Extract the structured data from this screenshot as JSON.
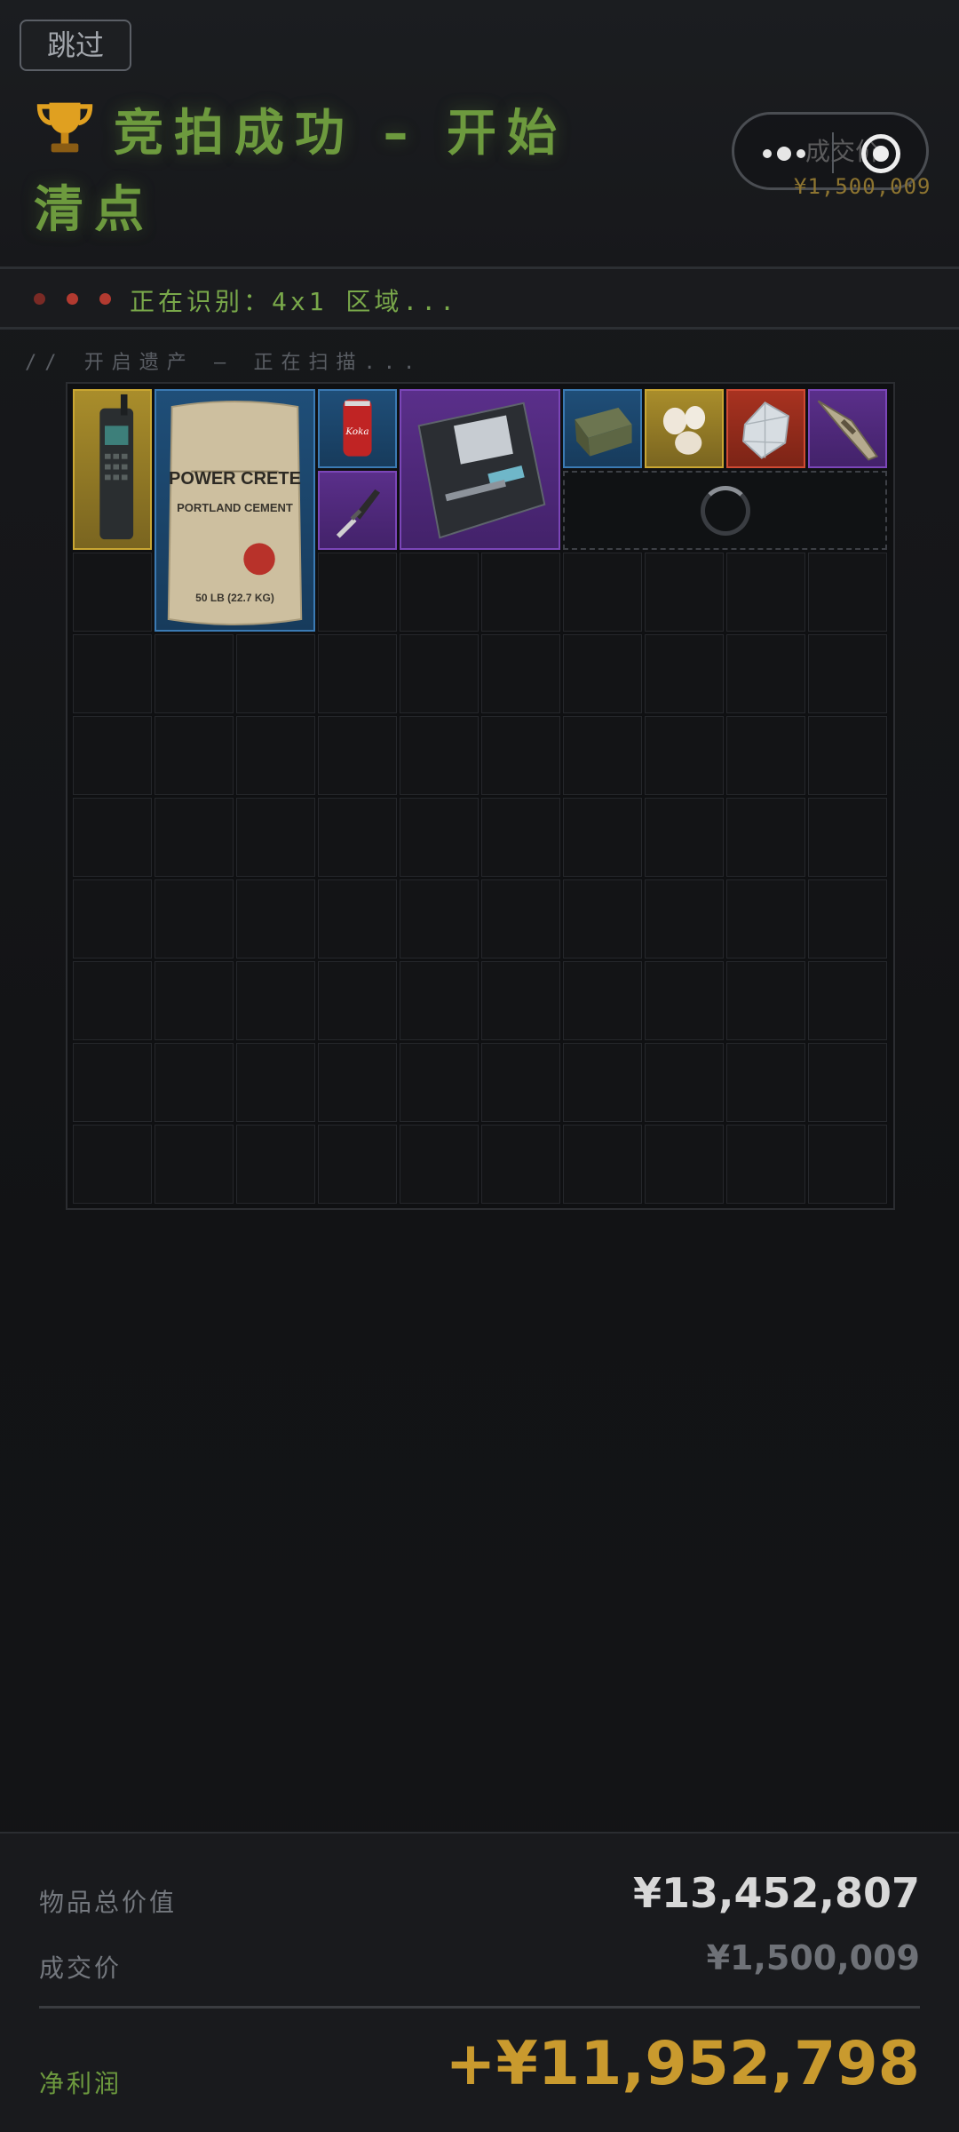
{
  "header": {
    "skip_label": "跳过",
    "title": "竞拍成功 – 开始清点",
    "capsule_ghost": "成交价",
    "deal_price_small": "¥1,500,009"
  },
  "status": {
    "text": "正在识别：4x1 区域..."
  },
  "scan_caption": "// 开启遗产 – 正在扫描...",
  "grid": {
    "columns": 10,
    "rows": 10
  },
  "items": [
    {
      "name": "satellite-phone",
      "rarity": "gold",
      "col": 0,
      "row": 0,
      "w": 1,
      "h": 2
    },
    {
      "name": "cement-bag",
      "rarity": "blue",
      "col": 1,
      "row": 0,
      "w": 2,
      "h": 3,
      "label": "POWER CRETE",
      "sub": "PORTLAND CEMENT",
      "weight": "50 LB (22.7 KG)"
    },
    {
      "name": "soda-can",
      "rarity": "blue",
      "col": 3,
      "row": 0,
      "w": 1,
      "h": 1
    },
    {
      "name": "knife",
      "rarity": "purple",
      "col": 3,
      "row": 1,
      "w": 1,
      "h": 1
    },
    {
      "name": "motherboard",
      "rarity": "purple",
      "col": 4,
      "row": 0,
      "w": 2,
      "h": 2
    },
    {
      "name": "ammo-tin",
      "rarity": "blue",
      "col": 6,
      "row": 0,
      "w": 1,
      "h": 1
    },
    {
      "name": "pearls",
      "rarity": "gold",
      "col": 7,
      "row": 0,
      "w": 1,
      "h": 1
    },
    {
      "name": "diamond",
      "rarity": "red",
      "col": 8,
      "row": 0,
      "w": 1,
      "h": 1
    },
    {
      "name": "spear-head",
      "rarity": "purple",
      "col": 9,
      "row": 0,
      "w": 1,
      "h": 1
    }
  ],
  "scanning_slot": {
    "col": 6,
    "row": 1,
    "w": 4,
    "h": 1
  },
  "summary": {
    "total_label": "物品总价值",
    "total_value": "¥13,452,807",
    "deal_label": "成交价",
    "deal_value": "¥1,500,009",
    "net_label": "净利润",
    "net_value": "+¥11,952,798"
  },
  "colors": {
    "accent_green": "#6d9a3e",
    "accent_gold": "#c99a2e",
    "rarity_gold": "#c9a632",
    "rarity_blue": "#3b7ab3",
    "rarity_purple": "#7b46b8",
    "rarity_red": "#cf4a33"
  }
}
